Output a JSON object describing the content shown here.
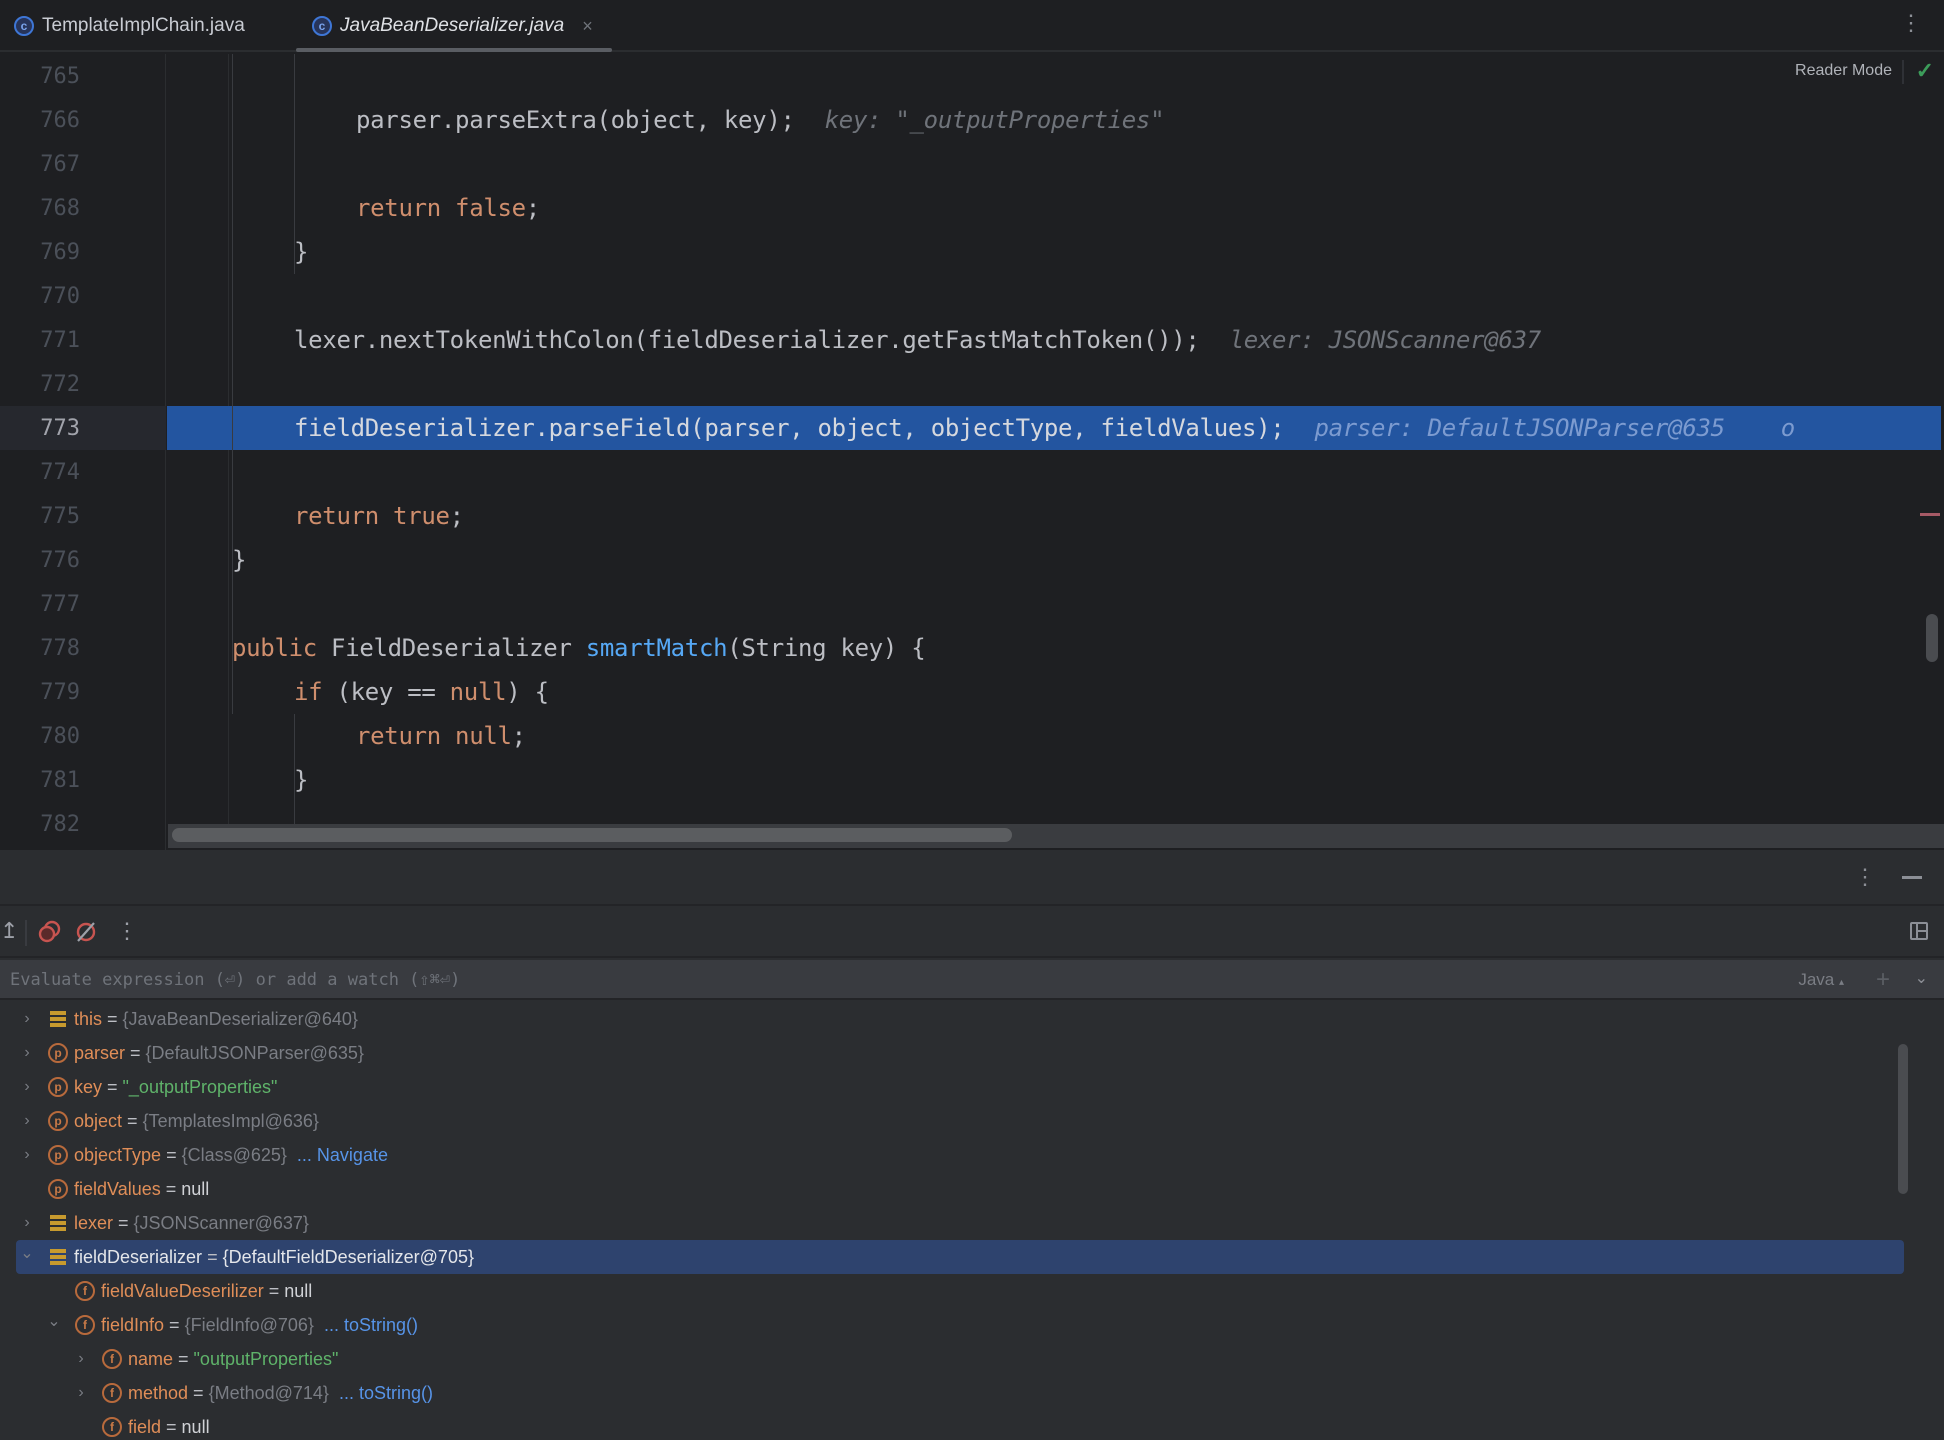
{
  "tabs": [
    {
      "label": "TemplateImplChain.java",
      "icon": "class-icon",
      "active": false
    },
    {
      "label": "JavaBeanDeserializer.java",
      "icon": "class-icon",
      "active": true,
      "closable": true
    }
  ],
  "editor": {
    "reader_mode_label": "Reader Mode",
    "inspection_status": "check-icon",
    "current_line": 773,
    "lines": [
      {
        "n": "765",
        "code": ""
      },
      {
        "n": "766",
        "code": "parser.parseExtra(object, key);",
        "hint": "key: \"_outputProperties\""
      },
      {
        "n": "767",
        "code": ""
      },
      {
        "n": "768",
        "kw": "return false",
        "tail": ";"
      },
      {
        "n": "769",
        "code": "}"
      },
      {
        "n": "770",
        "code": ""
      },
      {
        "n": "771",
        "code": "lexer.nextTokenWithColon(fieldDeserializer.getFastMatchToken());",
        "hint": "lexer: JSONScanner@637"
      },
      {
        "n": "772",
        "code": ""
      },
      {
        "n": "773",
        "code": "fieldDeserializer.parseField(parser, object, objectType, fieldValues);",
        "hint": "parser: DefaultJSONParser@635",
        "hint_overflow": "o"
      },
      {
        "n": "774",
        "code": ""
      },
      {
        "n": "775",
        "kw": "return true",
        "tail": ";"
      },
      {
        "n": "776",
        "code": "}"
      },
      {
        "n": "777",
        "code": ""
      },
      {
        "n": "778",
        "kw": "public",
        "type": " FieldDeserializer ",
        "fn": "smartMatch",
        "tail": "(String key) {"
      },
      {
        "n": "779",
        "kw": "if",
        "mid": " (key == ",
        "kw2": "null",
        "tail": ") {"
      },
      {
        "n": "780",
        "kw": "return null",
        "tail": ";"
      },
      {
        "n": "781",
        "code": "}"
      },
      {
        "n": "782",
        "code": ""
      }
    ]
  },
  "debug": {
    "toolbar": {
      "more_label": "⋮",
      "minimize_label": "—"
    },
    "eval": {
      "placeholder": "Evaluate expression (⏎) or add a watch (⇧⌘⏎)",
      "language": "Java",
      "language_suffix": "▴"
    },
    "variables": [
      {
        "depth": 0,
        "expand": ">",
        "icon": "static",
        "name": "this",
        "value": "{JavaBeanDeserializer@640}",
        "vtype": "obj"
      },
      {
        "depth": 0,
        "expand": ">",
        "icon": "param",
        "name": "parser",
        "value": "{DefaultJSONParser@635}",
        "vtype": "obj"
      },
      {
        "depth": 0,
        "expand": ">",
        "icon": "param",
        "name": "key",
        "value": "\"_outputProperties\"",
        "vtype": "str"
      },
      {
        "depth": 0,
        "expand": ">",
        "icon": "param",
        "name": "object",
        "value": "{TemplatesImpl@636}",
        "vtype": "obj"
      },
      {
        "depth": 0,
        "expand": ">",
        "icon": "param",
        "name": "objectType",
        "value": "{Class@625}",
        "vtype": "obj",
        "link": "... Navigate"
      },
      {
        "depth": 0,
        "expand": "",
        "icon": "param",
        "name": "fieldValues",
        "value": "null",
        "vtype": "null"
      },
      {
        "depth": 0,
        "expand": ">",
        "icon": "static",
        "name": "lexer",
        "value": "{JSONScanner@637}",
        "vtype": "obj"
      },
      {
        "depth": 0,
        "expand": "v",
        "icon": "static",
        "name": "fieldDeserializer",
        "value": "{DefaultFieldDeserializer@705}",
        "vtype": "obj",
        "selected": true
      },
      {
        "depth": 1,
        "expand": "",
        "icon": "field",
        "name": "fieldValueDeserilizer",
        "value": "null",
        "vtype": "null"
      },
      {
        "depth": 1,
        "expand": "v",
        "icon": "field",
        "name": "fieldInfo",
        "value": "{FieldInfo@706}",
        "vtype": "obj",
        "link": "... toString()"
      },
      {
        "depth": 2,
        "expand": ">",
        "icon": "field",
        "name": "name",
        "value": "\"outputProperties\"",
        "vtype": "str"
      },
      {
        "depth": 2,
        "expand": ">",
        "icon": "field",
        "name": "method",
        "value": "{Method@714}",
        "vtype": "obj",
        "link": "... toString()"
      },
      {
        "depth": 2,
        "expand": "",
        "icon": "field",
        "name": "field",
        "value": "null",
        "vtype": "null"
      }
    ]
  },
  "colors": {
    "keyword": "#cf8e6d",
    "function": "#56a8f5",
    "string": "#5fb36a",
    "link": "#5794e8",
    "execution_line": "#2355a0",
    "selection": "#2e436e"
  }
}
